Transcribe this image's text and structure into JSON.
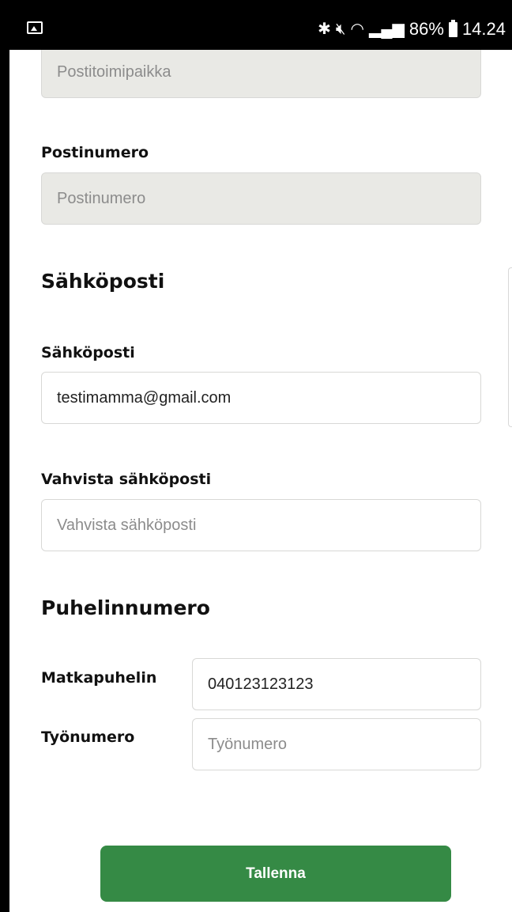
{
  "status_bar": {
    "left_icon": "image-notification-icon",
    "right_icons": [
      "bluetooth-icon",
      "mute-icon",
      "wifi-icon",
      "signal-icon"
    ],
    "battery_percent": "86%",
    "time": "14.24"
  },
  "form": {
    "postitoimipaikka": {
      "placeholder": "Postitoimipaikka"
    },
    "postinumero": {
      "label": "Postinumero",
      "placeholder": "Postinumero"
    },
    "email_section": {
      "heading": "Sähköposti",
      "email": {
        "label": "Sähköposti",
        "value": "testimamma@gmail.com"
      },
      "confirm": {
        "label": "Vahvista sähköposti",
        "placeholder": "Vahvista sähköposti"
      }
    },
    "phone_section": {
      "heading": "Puhelinnumero",
      "mobile": {
        "label": "Matkapuhelin",
        "value": "040123123123"
      },
      "work": {
        "label": "Työnumero",
        "placeholder": "Työnumero"
      }
    },
    "save_label": "Tallenna"
  },
  "colors": {
    "accent": "#358a45",
    "disabled_bg": "#e9e9e5",
    "border": "#d8d8d6"
  }
}
